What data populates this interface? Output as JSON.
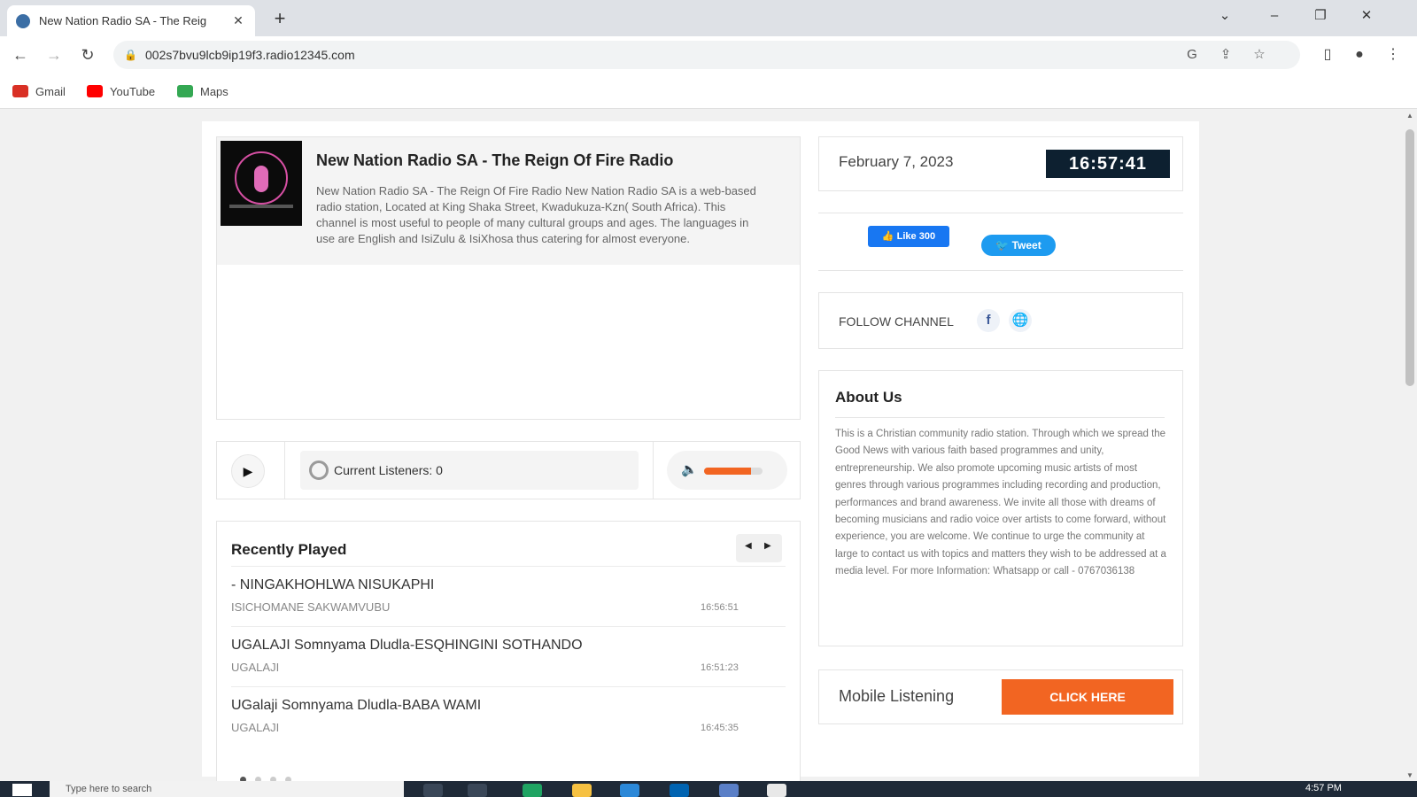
{
  "browser": {
    "tab_title": "New Nation Radio SA - The Reig",
    "tab_close": "✕",
    "new_tab": "+",
    "url": "002s7bvu9lcb9ip19f3.radio12345.com",
    "window_controls": [
      "⌄",
      "–",
      "❐",
      "✕"
    ],
    "bookmarks": [
      {
        "label": "Gmail",
        "color": "#d93025"
      },
      {
        "label": "YouTube",
        "color": "#ff0000"
      },
      {
        "label": "Maps",
        "color": "#34a853"
      }
    ]
  },
  "station": {
    "name": "New Nation Radio SA - The Reign Of Fire Radio",
    "description": "New Nation Radio SA - The Reign Of Fire Radio New Nation Radio SA is a web-based radio station, Located at King Shaka Street, Kwadukuza-Kzn( South Africa). This channel is most useful to people of many cultural groups and ages. The languages in use are English and IsiZulu & IsiXhosa thus catering for almost everyone."
  },
  "player": {
    "play_icon": "▶",
    "listeners_label": "Current Listeners: 0",
    "speaker_icon": "🔈",
    "volume_level": 0.8,
    "accent": "#f26522"
  },
  "recent": {
    "title": "Recently Played",
    "prev": "◀",
    "next": "▶",
    "tracks": [
      {
        "title": "- NINGAKHOHLWA NISUKAPHI",
        "artist": "ISICHOMANE SAKWAMVUBU",
        "time": "16:56:51"
      },
      {
        "title": "UGALAJI Somnyama Dludla-ESQHINGINI SOTHANDO",
        "artist": "UGALAJI",
        "time": "16:51:23"
      },
      {
        "title": "UGalaji Somnyama Dludla-BABA WAMI",
        "artist": "UGALAJI",
        "time": "16:45:35"
      }
    ]
  },
  "sidebar": {
    "date": "February 7, 2023",
    "clock": "16:57:41",
    "fb_like": "👍 Like 300",
    "tweet": "🐦 Tweet",
    "follow_label": "FOLLOW CHANNEL",
    "follow_fb": "f",
    "follow_web": "🌐",
    "about_title": "About Us",
    "about_text": "This is a Christian community radio station. Through which we spread the Good News with various faith based programmes and unity, entrepreneurship. We also promote upcoming music artists of most genres through various programmes including recording and production, performances and brand awareness. We invite all those with dreams of becoming musicians and radio voice over artists to come forward, without experience, you are welcome. We continue to urge the community at large to contact us with topics and matters they wish to be addressed at a media level. For more Information: Whatsapp or call - 0767036138",
    "mobile_label": "Mobile Listening",
    "mobile_button": "CLICK HERE"
  },
  "taskbar": {
    "search_placeholder": "Type here to search",
    "time": "4:57 PM"
  }
}
